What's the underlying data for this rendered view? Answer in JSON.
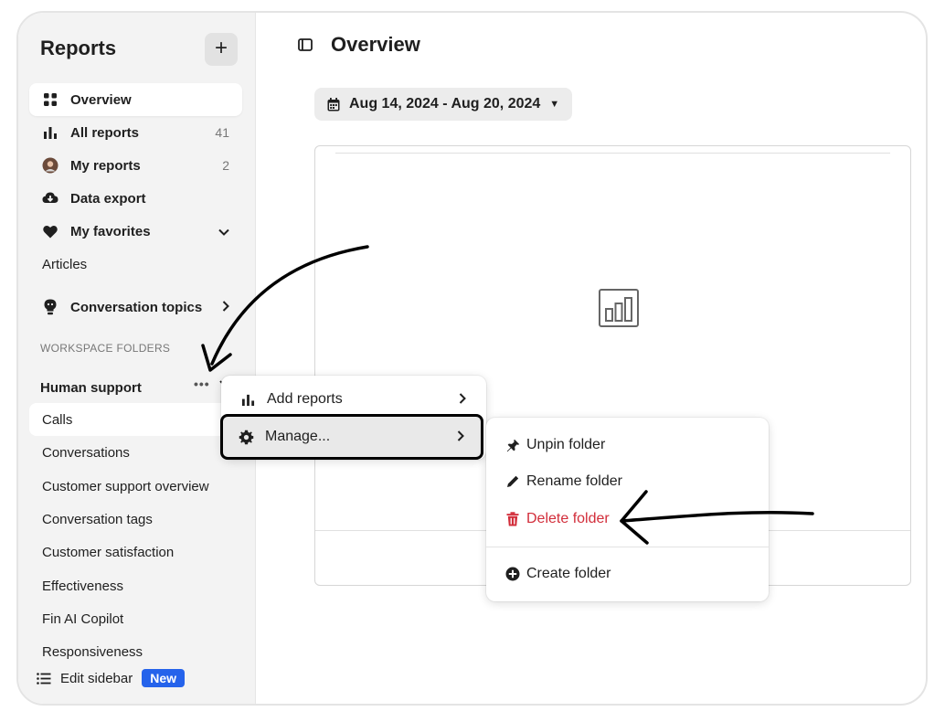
{
  "sidebar": {
    "title": "Reports",
    "add_label": "+",
    "items": [
      {
        "label": "Overview",
        "count": ""
      },
      {
        "label": "All reports",
        "count": "41"
      },
      {
        "label": "My reports",
        "count": "2"
      },
      {
        "label": "Data export",
        "count": ""
      },
      {
        "label": "My favorites",
        "count": ""
      }
    ],
    "articles_label": "Articles",
    "topics_label": "Conversation topics",
    "section_label": "WORKSPACE FOLDERS",
    "folder_name": "Human support",
    "folder_dots": "•••",
    "folder_items": [
      "Calls",
      "Conversations",
      "Customer support overview",
      "Conversation tags",
      "Customer satisfaction",
      "Effectiveness",
      "Fin AI Copilot",
      "Responsiveness"
    ],
    "edit_label": "Edit sidebar",
    "new_badge": "New"
  },
  "main": {
    "title": "Overview",
    "date_range": "Aug 14, 2024 - Aug 20, 2024"
  },
  "context_menu": {
    "add_reports": "Add reports",
    "manage": "Manage..."
  },
  "submenu": {
    "unpin": "Unpin folder",
    "rename": "Rename folder",
    "delete": "Delete folder",
    "create": "Create folder"
  },
  "colors": {
    "accent_blue": "#2563eb",
    "danger_red": "#d22d3a",
    "sidebar_bg": "#f3f3f3"
  }
}
